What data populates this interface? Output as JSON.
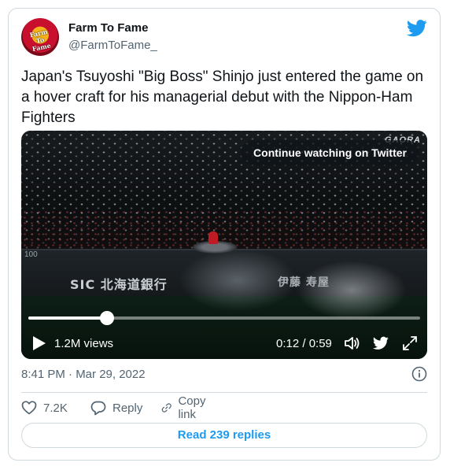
{
  "author": {
    "name": "Farm To Fame",
    "handle": "@FarmToFame_",
    "avatar_text": "Farm To Fame"
  },
  "tweet": {
    "text": "Japan's Tsuyoshi \"Big Boss\" Shinjo just entered the game on a hover craft for his managerial debut with the Nippon-Ham Fighters",
    "timestamp": "8:41 PM · Mar 29, 2022"
  },
  "video": {
    "continue_label": "Continue watching on Twitter",
    "views": "1.2M views",
    "time": "0:12 / 0:59",
    "progress": 0.2,
    "scene_text_left": "SIC 北海道銀行",
    "scene_text_right": "伊藤 寿屋",
    "corner_logo": "GAORA",
    "wall_number": "100"
  },
  "actions": {
    "like_count": "7.2K",
    "reply_label": "Reply",
    "copy_link_label": "Copy link"
  },
  "replies_button": "Read 239 replies",
  "colors": {
    "accent": "#1d9bf0",
    "text": "#0f1419",
    "secondary": "#536471",
    "border": "#cfd9de"
  },
  "icons": [
    "twitter-bird-icon",
    "play-icon",
    "volume-icon",
    "fullscreen-icon",
    "info-icon",
    "heart-icon",
    "reply-icon",
    "link-icon"
  ]
}
